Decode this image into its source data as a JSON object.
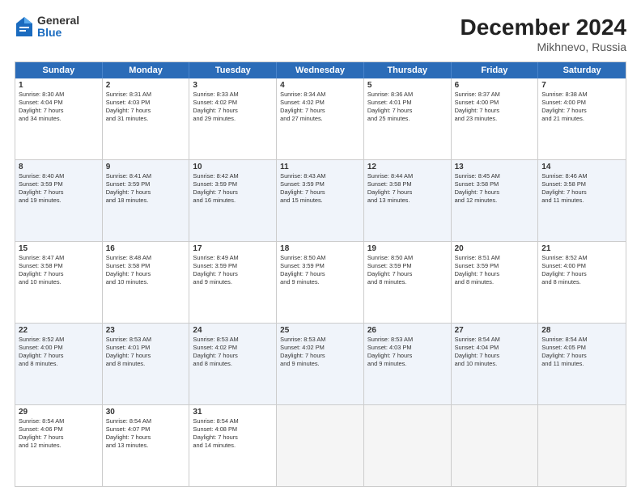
{
  "logo": {
    "general": "General",
    "blue": "Blue"
  },
  "title": "December 2024",
  "subtitle": "Mikhnevo, Russia",
  "days": [
    "Sunday",
    "Monday",
    "Tuesday",
    "Wednesday",
    "Thursday",
    "Friday",
    "Saturday"
  ],
  "rows": [
    [
      {
        "num": "1",
        "lines": [
          "Sunrise: 8:30 AM",
          "Sunset: 4:04 PM",
          "Daylight: 7 hours",
          "and 34 minutes."
        ]
      },
      {
        "num": "2",
        "lines": [
          "Sunrise: 8:31 AM",
          "Sunset: 4:03 PM",
          "Daylight: 7 hours",
          "and 31 minutes."
        ]
      },
      {
        "num": "3",
        "lines": [
          "Sunrise: 8:33 AM",
          "Sunset: 4:02 PM",
          "Daylight: 7 hours",
          "and 29 minutes."
        ]
      },
      {
        "num": "4",
        "lines": [
          "Sunrise: 8:34 AM",
          "Sunset: 4:02 PM",
          "Daylight: 7 hours",
          "and 27 minutes."
        ]
      },
      {
        "num": "5",
        "lines": [
          "Sunrise: 8:36 AM",
          "Sunset: 4:01 PM",
          "Daylight: 7 hours",
          "and 25 minutes."
        ]
      },
      {
        "num": "6",
        "lines": [
          "Sunrise: 8:37 AM",
          "Sunset: 4:00 PM",
          "Daylight: 7 hours",
          "and 23 minutes."
        ]
      },
      {
        "num": "7",
        "lines": [
          "Sunrise: 8:38 AM",
          "Sunset: 4:00 PM",
          "Daylight: 7 hours",
          "and 21 minutes."
        ]
      }
    ],
    [
      {
        "num": "8",
        "lines": [
          "Sunrise: 8:40 AM",
          "Sunset: 3:59 PM",
          "Daylight: 7 hours",
          "and 19 minutes."
        ]
      },
      {
        "num": "9",
        "lines": [
          "Sunrise: 8:41 AM",
          "Sunset: 3:59 PM",
          "Daylight: 7 hours",
          "and 18 minutes."
        ]
      },
      {
        "num": "10",
        "lines": [
          "Sunrise: 8:42 AM",
          "Sunset: 3:59 PM",
          "Daylight: 7 hours",
          "and 16 minutes."
        ]
      },
      {
        "num": "11",
        "lines": [
          "Sunrise: 8:43 AM",
          "Sunset: 3:59 PM",
          "Daylight: 7 hours",
          "and 15 minutes."
        ]
      },
      {
        "num": "12",
        "lines": [
          "Sunrise: 8:44 AM",
          "Sunset: 3:58 PM",
          "Daylight: 7 hours",
          "and 13 minutes."
        ]
      },
      {
        "num": "13",
        "lines": [
          "Sunrise: 8:45 AM",
          "Sunset: 3:58 PM",
          "Daylight: 7 hours",
          "and 12 minutes."
        ]
      },
      {
        "num": "14",
        "lines": [
          "Sunrise: 8:46 AM",
          "Sunset: 3:58 PM",
          "Daylight: 7 hours",
          "and 11 minutes."
        ]
      }
    ],
    [
      {
        "num": "15",
        "lines": [
          "Sunrise: 8:47 AM",
          "Sunset: 3:58 PM",
          "Daylight: 7 hours",
          "and 10 minutes."
        ]
      },
      {
        "num": "16",
        "lines": [
          "Sunrise: 8:48 AM",
          "Sunset: 3:58 PM",
          "Daylight: 7 hours",
          "and 10 minutes."
        ]
      },
      {
        "num": "17",
        "lines": [
          "Sunrise: 8:49 AM",
          "Sunset: 3:59 PM",
          "Daylight: 7 hours",
          "and 9 minutes."
        ]
      },
      {
        "num": "18",
        "lines": [
          "Sunrise: 8:50 AM",
          "Sunset: 3:59 PM",
          "Daylight: 7 hours",
          "and 9 minutes."
        ]
      },
      {
        "num": "19",
        "lines": [
          "Sunrise: 8:50 AM",
          "Sunset: 3:59 PM",
          "Daylight: 7 hours",
          "and 8 minutes."
        ]
      },
      {
        "num": "20",
        "lines": [
          "Sunrise: 8:51 AM",
          "Sunset: 3:59 PM",
          "Daylight: 7 hours",
          "and 8 minutes."
        ]
      },
      {
        "num": "21",
        "lines": [
          "Sunrise: 8:52 AM",
          "Sunset: 4:00 PM",
          "Daylight: 7 hours",
          "and 8 minutes."
        ]
      }
    ],
    [
      {
        "num": "22",
        "lines": [
          "Sunrise: 8:52 AM",
          "Sunset: 4:00 PM",
          "Daylight: 7 hours",
          "and 8 minutes."
        ]
      },
      {
        "num": "23",
        "lines": [
          "Sunrise: 8:53 AM",
          "Sunset: 4:01 PM",
          "Daylight: 7 hours",
          "and 8 minutes."
        ]
      },
      {
        "num": "24",
        "lines": [
          "Sunrise: 8:53 AM",
          "Sunset: 4:02 PM",
          "Daylight: 7 hours",
          "and 8 minutes."
        ]
      },
      {
        "num": "25",
        "lines": [
          "Sunrise: 8:53 AM",
          "Sunset: 4:02 PM",
          "Daylight: 7 hours",
          "and 9 minutes."
        ]
      },
      {
        "num": "26",
        "lines": [
          "Sunrise: 8:53 AM",
          "Sunset: 4:03 PM",
          "Daylight: 7 hours",
          "and 9 minutes."
        ]
      },
      {
        "num": "27",
        "lines": [
          "Sunrise: 8:54 AM",
          "Sunset: 4:04 PM",
          "Daylight: 7 hours",
          "and 10 minutes."
        ]
      },
      {
        "num": "28",
        "lines": [
          "Sunrise: 8:54 AM",
          "Sunset: 4:05 PM",
          "Daylight: 7 hours",
          "and 11 minutes."
        ]
      }
    ],
    [
      {
        "num": "29",
        "lines": [
          "Sunrise: 8:54 AM",
          "Sunset: 4:06 PM",
          "Daylight: 7 hours",
          "and 12 minutes."
        ]
      },
      {
        "num": "30",
        "lines": [
          "Sunrise: 8:54 AM",
          "Sunset: 4:07 PM",
          "Daylight: 7 hours",
          "and 13 minutes."
        ]
      },
      {
        "num": "31",
        "lines": [
          "Sunrise: 8:54 AM",
          "Sunset: 4:08 PM",
          "Daylight: 7 hours",
          "and 14 minutes."
        ]
      },
      {
        "num": "",
        "lines": []
      },
      {
        "num": "",
        "lines": []
      },
      {
        "num": "",
        "lines": []
      },
      {
        "num": "",
        "lines": []
      }
    ]
  ]
}
